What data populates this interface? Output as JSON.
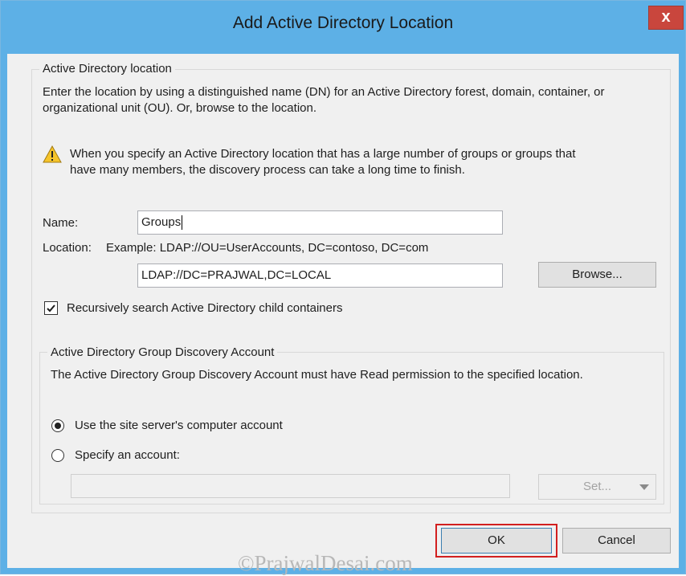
{
  "window": {
    "title": "Add Active Directory Location",
    "close_label": "x"
  },
  "location_group": {
    "legend": "Active Directory location",
    "description_line1": "Enter the location by using a distinguished name (DN) for an Active Directory forest, domain, container, or",
    "description_line2": "organizational unit (OU). Or, browse to the location.",
    "warning_line1": "When you specify an Active Directory location that has a large number of groups or groups that",
    "warning_line2": "have many members, the discovery process can take a long time to finish.",
    "name_label": "Name:",
    "name_value": "Groups",
    "location_label": "Location:",
    "location_example": "Example: LDAP://OU=UserAccounts, DC=contoso, DC=com",
    "location_value": "LDAP://DC=PRAJWAL,DC=LOCAL",
    "browse_label": "Browse...",
    "recursive_label": "Recursively search Active Directory child containers",
    "recursive_checked": true
  },
  "account_group": {
    "legend": "Active Directory Group Discovery Account",
    "description": "The Active Directory Group Discovery Account must have Read permission to the specified location.",
    "option_site_server": "Use the site server's computer account",
    "option_specify": "Specify an account:",
    "selected_option": "site_server",
    "account_value": "",
    "set_label": "Set..."
  },
  "footer": {
    "ok_label": "OK",
    "cancel_label": "Cancel"
  },
  "watermark": "©PrajwalDesai.com",
  "colors": {
    "titlebar": "#5db0e6",
    "close": "#c9463d",
    "highlight": "#d21f1f"
  }
}
